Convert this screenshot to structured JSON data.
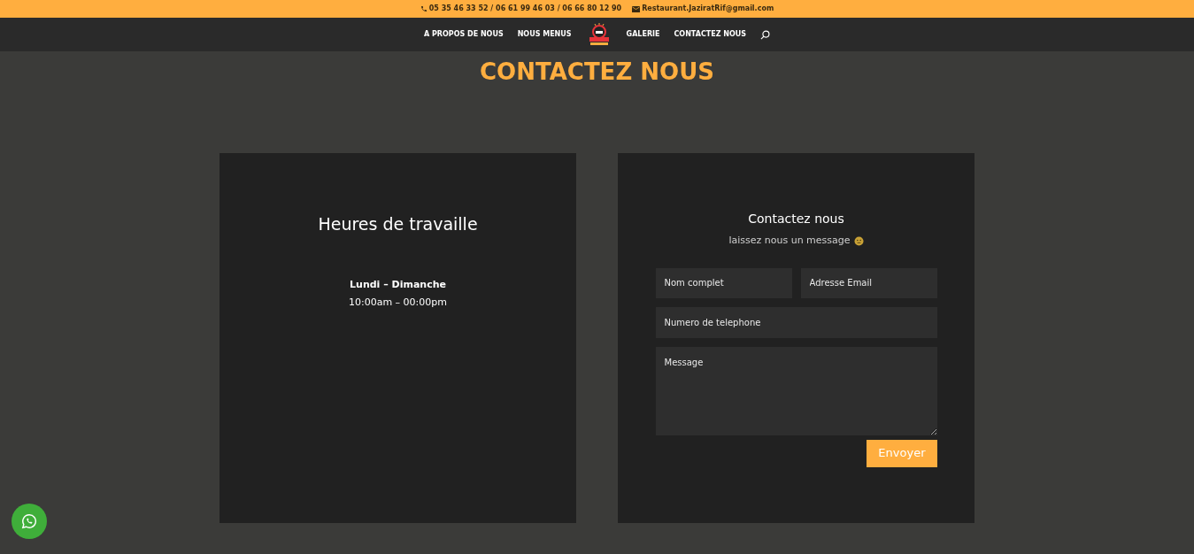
{
  "top_bar": {
    "phone": "05 35 46 33 52 / 06 61 99 46 03 / 06 66 80 12 90",
    "email": "Restaurant.JaziratRif@gmail.com"
  },
  "nav": {
    "left_items": [
      "A PROPOS DE NOUS",
      "NOUS MENUS"
    ],
    "right_items": [
      "GALERIE",
      "CONTACTEZ NOUS"
    ]
  },
  "page_title": "CONTACTEZ NOUS",
  "hours_card": {
    "title": "Heures de travaille",
    "days": "Lundi – Dimanche",
    "hours": "10:00am – 00:00pm"
  },
  "contact_card": {
    "title": "Contactez nous",
    "subtitle": "laissez nous un message",
    "fields": [
      {
        "kind": "half",
        "placeholder": "Nom complet"
      },
      {
        "kind": "half",
        "placeholder": "Adresse Email"
      },
      {
        "kind": "full",
        "placeholder": "Numero de telephone"
      },
      {
        "kind": "textarea",
        "placeholder": "Message"
      }
    ],
    "button": "Envoyer"
  }
}
